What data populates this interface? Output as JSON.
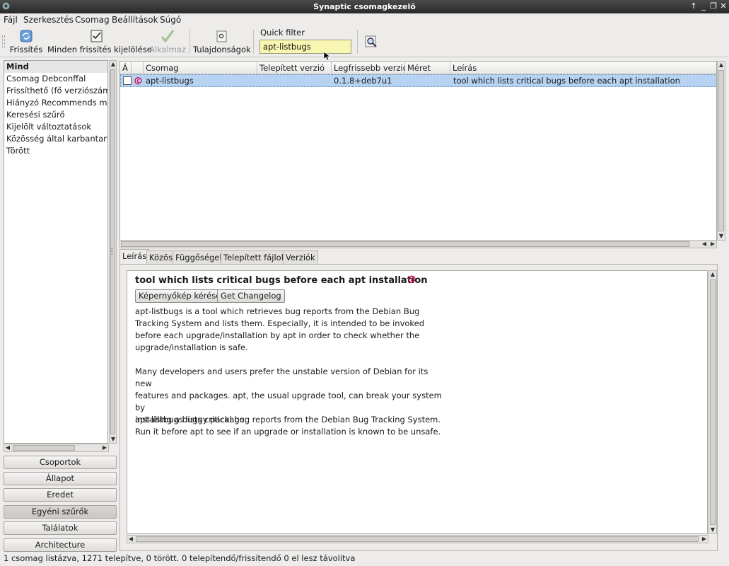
{
  "window": {
    "title": "Synaptic csomagkezelő"
  },
  "menu": [
    "Fájl",
    "Szerkesztés",
    "Csomag",
    "Beállítások",
    "Súgó"
  ],
  "toolbar": {
    "reload": "Frissítés",
    "mark_all": "Minden frissítés kijelölése",
    "apply": "Alkalmaz",
    "properties": "Tulajdonságok",
    "quick_filter_label": "Quick filter",
    "quick_filter_value": "apt-listbugs"
  },
  "filters": [
    "Mind",
    "Csomag Debconffal",
    "Frissíthető (fő verziószám v",
    "Hiányzó Recommends mez",
    "Keresési szűrő",
    "Kijelölt változtatások",
    "Közösség által karbantartot",
    "Törött"
  ],
  "side_buttons": [
    "Csoportok",
    "Állapot",
    "Eredet",
    "Egyéni szűrők",
    "Találatok",
    "Architecture"
  ],
  "table": {
    "columns": [
      "Á",
      "",
      "Csomag",
      "Telepített verzió",
      "Legfrissebb verzió",
      "Méret",
      "Leírás"
    ],
    "rows": [
      {
        "package": "apt-listbugs",
        "installed": "",
        "latest": "0.1.8+deb7u1",
        "size": "",
        "description": "tool which lists critical bugs before each apt installation"
      }
    ]
  },
  "tabs": [
    "Leírás",
    "Közös",
    "Függőségek",
    "Telepített fájlok",
    "Verziók"
  ],
  "detail": {
    "title": "tool which lists critical bugs before each apt installation",
    "screenshot_button": "Képernyőkép kérése",
    "changelog_button": "Get Changelog",
    "paragraphs": [
      [
        "apt-listbugs is a tool which retrieves bug reports from the Debian Bug",
        "Tracking System and lists them. Especially, it is intended to be invoked",
        "before each upgrade/installation by apt in order to check whether the",
        "upgrade/installation is safe."
      ],
      [
        "Many developers and users prefer the unstable version of Debian for its new",
        "features and packages.  apt, the usual upgrade tool, can break your system by",
        "installing a buggy package."
      ],
      [
        "apt-listbugs lists critical bug reports from the Debian Bug Tracking System.",
        "Run it before apt to see if an upgrade or installation is known to be unsafe."
      ]
    ]
  },
  "status": "1 csomag listázva, 1271 telepítve, 0 törött. 0 telepítendő/frissítendő 0 el lesz távolítva",
  "colors": {
    "selection": "#b7d3f2",
    "filter_bg": "#f8f6b0",
    "debian": "#d70751"
  }
}
